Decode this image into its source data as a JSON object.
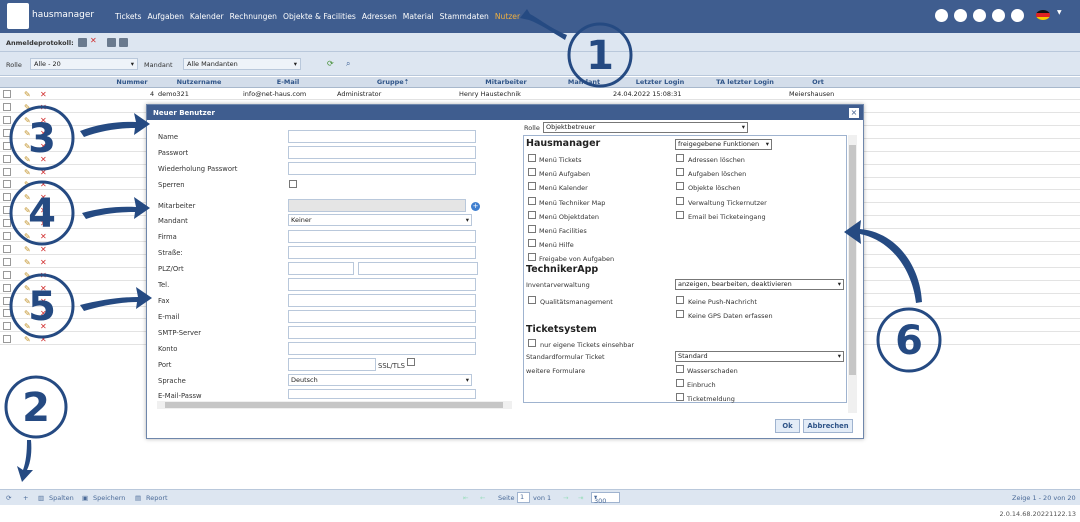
{
  "header": {
    "brand": "hausmanager",
    "nav": [
      "Tickets",
      "Aufgaben",
      "Kalender",
      "Rechnungen",
      "Objekte & Facilities",
      "Adressen",
      "Material",
      "Stammdaten",
      "Nutzer"
    ],
    "active_nav": "Nutzer",
    "icons": [
      "login-icon",
      "gear-icon",
      "user-icon",
      "help-icon",
      "power-icon"
    ],
    "language_flag": "de-flag-icon",
    "colors": {
      "header_bg": "#3f5d8f",
      "active": "#f0b040"
    }
  },
  "toolbar": {
    "login_protocol_label": "Anmeldeprotokoll:"
  },
  "filters": {
    "role_label": "Rolle",
    "role_value": "Alle - 20",
    "client_label": "Mandant",
    "client_value": "Alle Mandanten"
  },
  "table": {
    "columns": [
      "Nummer",
      "Nutzername",
      "E-Mail",
      "Gruppe",
      "Mitarbeiter",
      "Mandant",
      "Letzter Login",
      "TA letzter Login",
      "Ort"
    ],
    "sort_mark": "⇡",
    "rows": [
      {
        "nummer": "4",
        "nutzername": "demo321",
        "email": "info@net-haus.com",
        "gruppe": "Administrator",
        "mitarbeiter": "Henry Haustechnik",
        "letzter_login": "24.04.2022 15:08:31",
        "ort": "Meiershausen"
      }
    ]
  },
  "dialog": {
    "title": "Neuer Benutzer",
    "fields": {
      "name": "Name",
      "password": "Passwort",
      "password_repeat": "Wiederholung Passwort",
      "lock": "Sperren",
      "employee": "Mitarbeiter",
      "client": "Mandant",
      "client_value": "Keiner",
      "company": "Firma",
      "street": "Straße:",
      "zip_city": "PLZ/Ort",
      "phone": "Tel.",
      "fax": "Fax",
      "email": "E-mail",
      "smtp": "SMTP-Server",
      "account": "Konto",
      "port": "Port",
      "ssl": "SSL/TLS",
      "language": "Sprache",
      "language_value": "Deutsch",
      "email_password": "E-Mail-Passw"
    },
    "role_label": "Rolle",
    "role_value": "Objektbetreuer",
    "hausmanager": {
      "title": "Hausmanager",
      "select": "freigegebene Funktionen",
      "left": [
        "Menü Tickets",
        "Menü Aufgaben",
        "Menü Kalender",
        "Menü Techniker Map",
        "Menü Objektdaten",
        "Menü Facilities",
        "Menü Hilfe",
        "Freigabe von Aufgaben"
      ],
      "right": [
        "Adressen löschen",
        "Aufgaben löschen",
        "Objekte löschen",
        "Verwaltung Tickernutzer",
        "Email bei Ticketeingang"
      ]
    },
    "techniker": {
      "title": "TechnikerApp",
      "inventory_label": "Inventarverwaltung",
      "inventory_value": "anzeigen, bearbeiten, deaktivieren",
      "quality": "Qualitätsmanagement",
      "no_push": "Keine Push-Nachricht",
      "no_gps": "Keine GPS Daten erfassen"
    },
    "tickets": {
      "title": "Ticketsystem",
      "own_only": "nur eigene Tickets einsehbar",
      "std_form_label": "Standardformular Ticket",
      "std_form_value": "Standard",
      "other_forms_label": "weitere Formulare",
      "forms": [
        "Wasserschaden",
        "Einbruch",
        "Ticketmeldung"
      ]
    },
    "ok": "Ok",
    "cancel": "Abbrechen"
  },
  "bottom": {
    "split": "Spalten",
    "save": "Speichern",
    "report": "Report",
    "page_label": "Seite",
    "page_value": "1",
    "page_of": "von 1",
    "page_size": "300",
    "range": "Zeige 1 - 20 von 20"
  },
  "version": "2.0.14.68.20221122.13",
  "annotations": {
    "numbers": [
      "1",
      "2",
      "3",
      "4",
      "5",
      "6"
    ],
    "color": "#254a82"
  }
}
